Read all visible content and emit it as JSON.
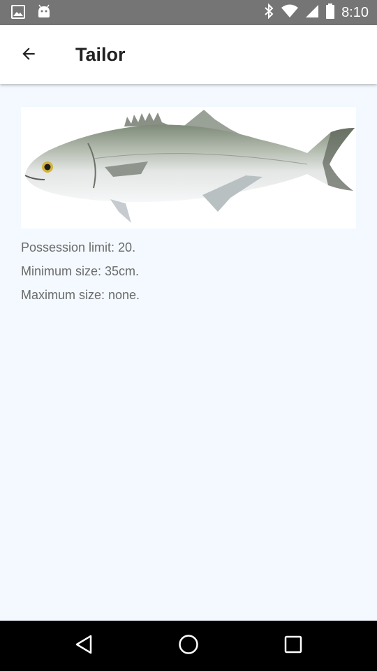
{
  "status_bar": {
    "time": "8:10",
    "left_icons": [
      "image-icon",
      "android-icon"
    ],
    "right_icons": [
      "bluetooth-icon",
      "wifi-icon",
      "signal-icon",
      "battery-icon"
    ]
  },
  "app_bar": {
    "title": "Tailor",
    "back_icon": "arrow-back-icon"
  },
  "content": {
    "image_subject": "fish",
    "possession_limit": "Possession limit: 20.",
    "minimum_size": "Minimum size: 35cm.",
    "maximum_size": "Maximum size: none."
  },
  "nav_bar": {
    "buttons": [
      "back-triangle-icon",
      "home-circle-icon",
      "recents-square-icon"
    ]
  },
  "colors": {
    "status_bar": "#757575",
    "app_bar": "#ffffff",
    "background": "#f3f9fe",
    "text_secondary": "#6b6b6b",
    "nav_bar": "#000000"
  }
}
